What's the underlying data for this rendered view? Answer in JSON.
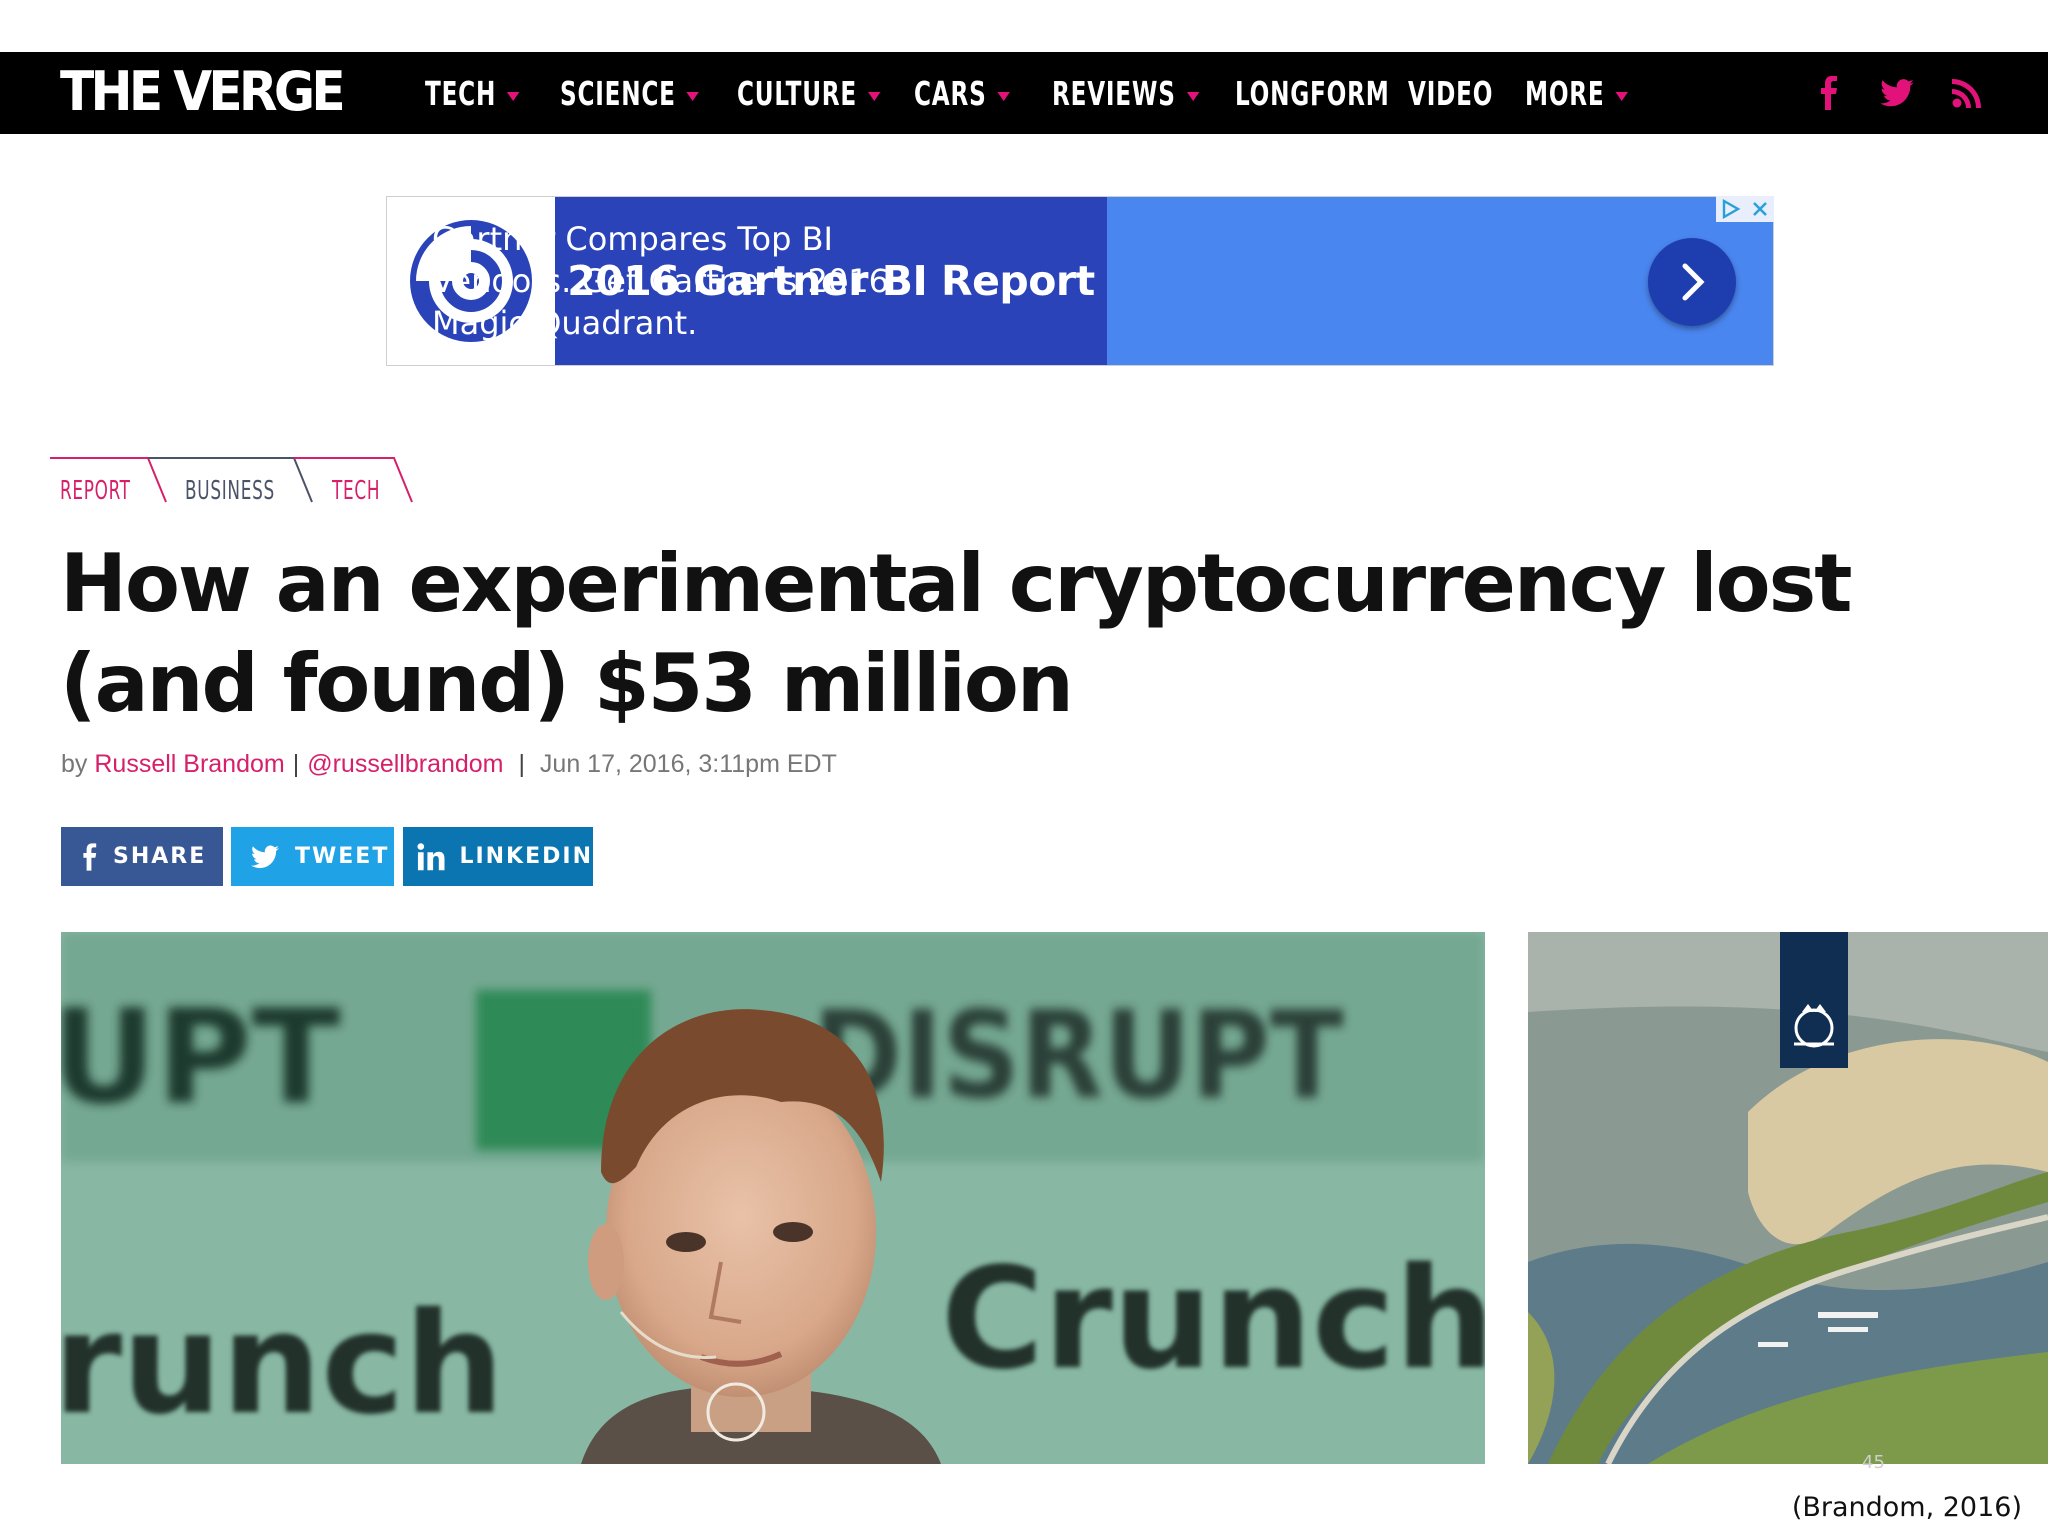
{
  "site": {
    "logo": "THE VERGE"
  },
  "nav": {
    "items": [
      {
        "label": "TECH",
        "has_dropdown": true
      },
      {
        "label": "SCIENCE",
        "has_dropdown": true
      },
      {
        "label": "CULTURE",
        "has_dropdown": true
      },
      {
        "label": "CARS",
        "has_dropdown": true
      },
      {
        "label": "REVIEWS",
        "has_dropdown": true
      },
      {
        "label": "LONGFORM",
        "has_dropdown": false
      },
      {
        "label": "VIDEO",
        "has_dropdown": false
      },
      {
        "label": "MORE",
        "has_dropdown": true
      }
    ],
    "social_icons": [
      "facebook-icon",
      "twitter-icon",
      "rss-icon"
    ],
    "accent_color": "#e2127a"
  },
  "ad": {
    "title": "2016 Gartner BI Report",
    "text": "Gartner Compares Top BI Vendors. Get Gartner's 2016 Magic Quadrant.",
    "colors": {
      "dark": "#2a43b8",
      "light": "#4a86f0"
    }
  },
  "article": {
    "breadcrumbs": [
      "REPORT",
      "BUSINESS",
      "TECH"
    ],
    "headline": "How an experimental cryptocurrency lost (and found) $53 million",
    "byline": {
      "prefix": "by",
      "author": "Russell Brandom",
      "handle": "@russellbrandom",
      "date": "Jun 17, 2016, 3:11pm EDT"
    },
    "share": {
      "facebook": "SHARE",
      "twitter": "TWEET",
      "linkedin": "LINKEDIN"
    },
    "hero_image_text": {
      "left": "UPT",
      "top": "DISRUPT",
      "lower_left": "runch",
      "lower_right": "Crunch"
    }
  },
  "slide": {
    "page_number": "45",
    "citation": "(Brandom, 2016)"
  }
}
